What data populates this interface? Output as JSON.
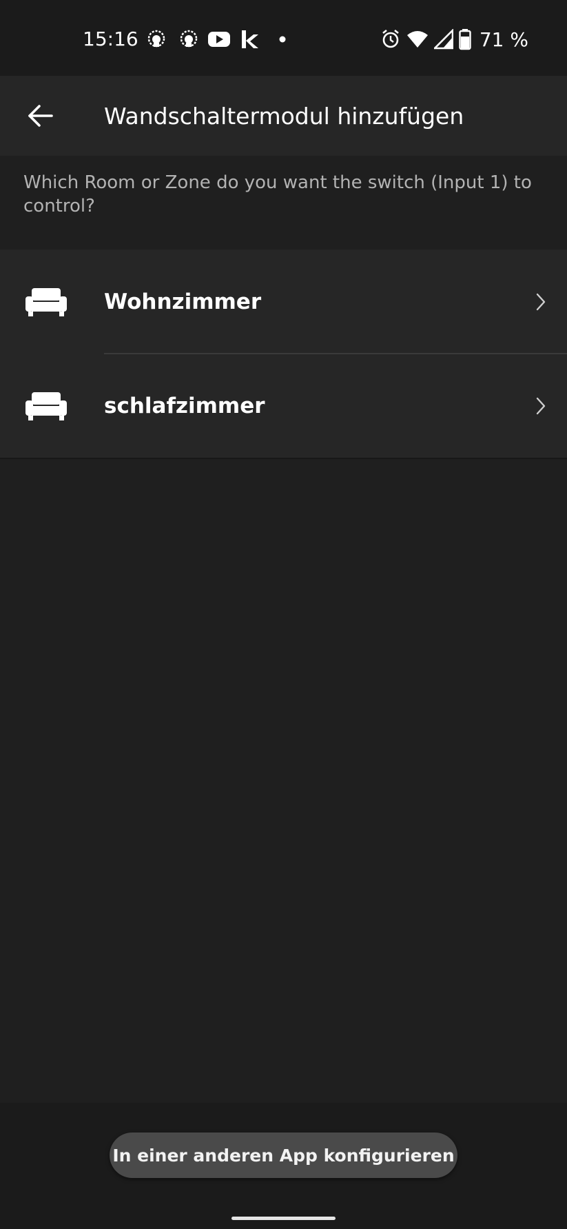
{
  "status_bar": {
    "time": "15:16",
    "battery_percent": "71 %",
    "icons": [
      "lion-app-icon",
      "lion-app-icon",
      "youtube-icon",
      "k-app-icon",
      "notification-dot-icon",
      "alarm-icon",
      "wifi-icon",
      "cellular-signal-icon",
      "battery-icon"
    ]
  },
  "app_bar": {
    "back_icon": "arrow-left-icon",
    "title": "Wandschaltermodul hinzufügen"
  },
  "prompt": "Which Room or Zone do you want the switch (Input 1) to control?",
  "rooms": [
    {
      "label": "Wohnzimmer",
      "icon": "sofa-icon"
    },
    {
      "label": "schlafzimmer",
      "icon": "sofa-icon"
    }
  ],
  "bottom": {
    "config_button_label": "In einer anderen App konfigurieren"
  },
  "colors": {
    "background": "#1f1f1f",
    "surface": "#262626",
    "button": "#4a4a4a",
    "secondary_text": "#b3b3b3"
  }
}
